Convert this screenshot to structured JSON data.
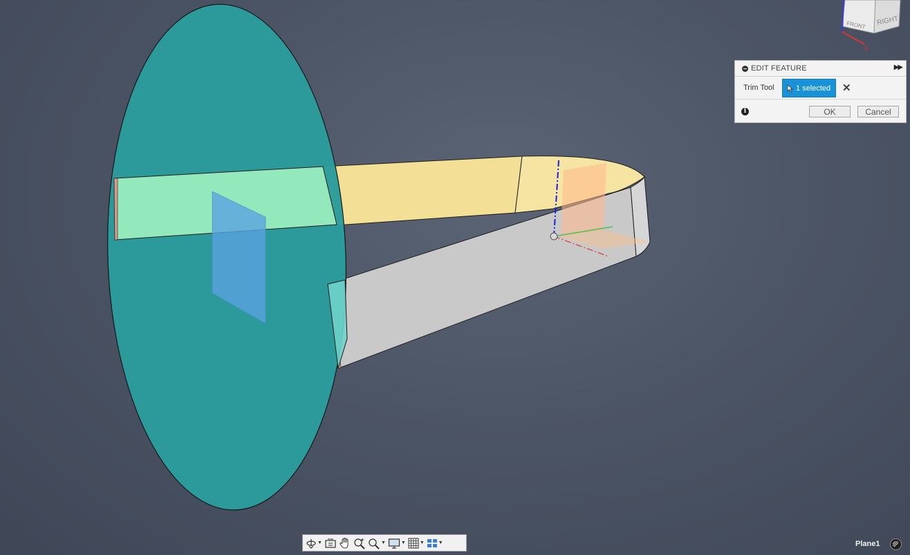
{
  "viewcube": {
    "front_label": "FRONT",
    "right_label": "RIGHT",
    "axis_label": "X"
  },
  "edit_feature": {
    "title": "EDIT FEATURE",
    "tool_label": "Trim Tool",
    "selection_label": "1 selected",
    "ok_label": "OK",
    "cancel_label": "Cancel"
  },
  "status": {
    "active_object": "Plane1"
  },
  "toolbar": {
    "items": [
      "orbit-icon",
      "look-at-icon",
      "pan-icon",
      "zoom-icon",
      "fit-icon",
      "display-settings-icon",
      "grid-icon",
      "viewports-icon"
    ]
  },
  "colors": {
    "background": "#4c5565",
    "disc": "#2a9a9a",
    "yellow_surface": "#f5e29a",
    "gray_surface": "#c4c4c4",
    "selection_blue": "#1a92d8"
  }
}
